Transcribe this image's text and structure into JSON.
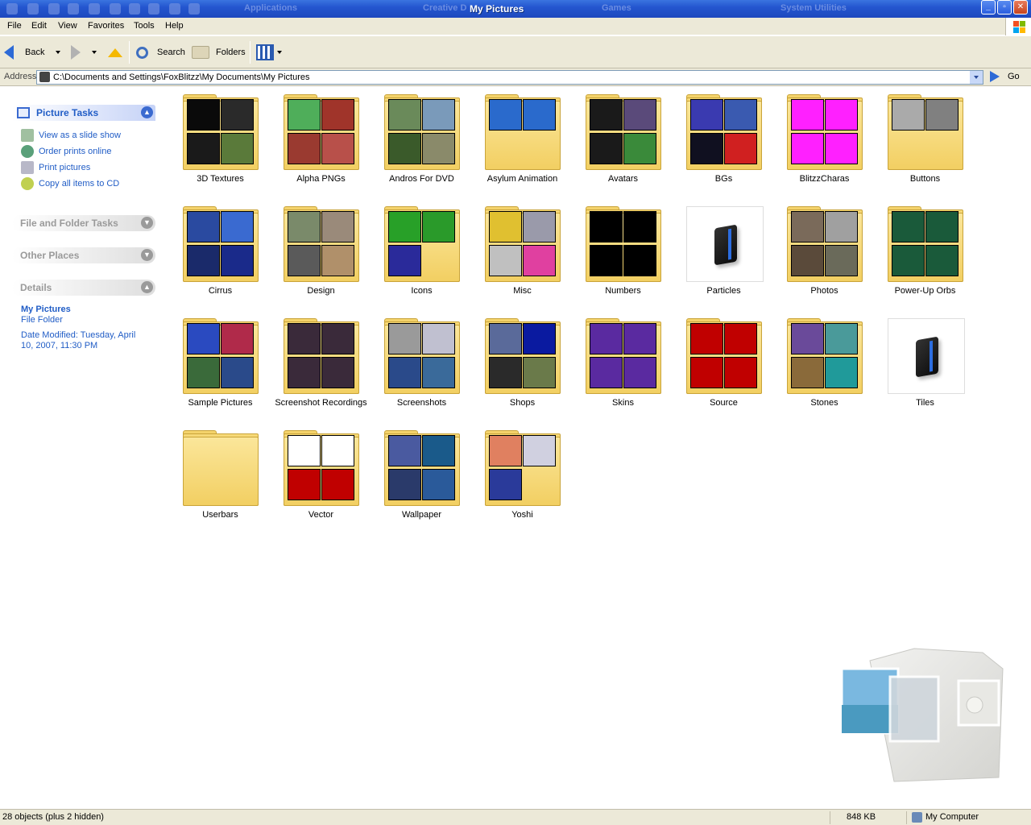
{
  "window": {
    "title": "My Pictures"
  },
  "taskbar_ghost": [
    "Applications",
    "Creative D",
    "Games",
    "System Utilities"
  ],
  "menu": [
    "File",
    "Edit",
    "View",
    "Favorites",
    "Tools",
    "Help"
  ],
  "toolbar": {
    "back": "Back",
    "search": "Search",
    "folders": "Folders"
  },
  "address": {
    "label": "Address",
    "path": "C:\\Documents and Settings\\FoxBlitzz\\My Documents\\My Pictures",
    "go": "Go"
  },
  "sidebar": {
    "picture_tasks": {
      "title": "Picture Tasks",
      "links": [
        "View as a slide show",
        "Order prints online",
        "Print pictures",
        "Copy all items to CD"
      ]
    },
    "file_folder_tasks": "File and Folder Tasks",
    "other_places": "Other Places",
    "details": {
      "title": "Details",
      "name": "My Pictures",
      "type": "File Folder",
      "modified_1": "Date Modified: Tuesday, April",
      "modified_2": "10, 2007, 11:30 PM"
    }
  },
  "items": [
    {
      "name": "3D Textures",
      "kind": "folder",
      "thumbs": [
        "#0a0a0a",
        "#2a2a2a",
        "#1a1a1a",
        "#5a7a3a"
      ]
    },
    {
      "name": "Alpha PNGs",
      "kind": "folder",
      "thumbs": [
        "#4fae5a",
        "#a0342a",
        "#9a3a30",
        "#b8504a"
      ]
    },
    {
      "name": "Andros For DVD",
      "kind": "folder",
      "thumbs": [
        "#6a8a5a",
        "#7a9aba",
        "#3a5a2a",
        "#8a8a6a"
      ]
    },
    {
      "name": "Asylum Animation",
      "kind": "folder",
      "thumbs": [
        "#2a6acc",
        "#2a6acc"
      ]
    },
    {
      "name": "Avatars",
      "kind": "folder",
      "thumbs": [
        "#1a1a1a",
        "#5a4a7a",
        "#1a1a1a",
        "#3a8a3a"
      ]
    },
    {
      "name": "BGs",
      "kind": "folder",
      "thumbs": [
        "#3a3ab0",
        "#3a5ab0",
        "#101020",
        "#d02020"
      ]
    },
    {
      "name": "BlitzzCharas",
      "kind": "folder",
      "thumbs": [
        "#ff20ff",
        "#ff20ff",
        "#ff20ff",
        "#ff20ff"
      ]
    },
    {
      "name": "Buttons",
      "kind": "folder",
      "thumbs": [
        "#aaaaaa",
        "#808080"
      ]
    },
    {
      "name": "Cirrus",
      "kind": "folder",
      "thumbs": [
        "#2a4aa0",
        "#3a6ad0",
        "#1a2a6a",
        "#1a2a8a"
      ]
    },
    {
      "name": "Design",
      "kind": "folder",
      "thumbs": [
        "#7a8a6a",
        "#9a8a7a",
        "#5a5a5a",
        "#b0906a"
      ]
    },
    {
      "name": "Icons",
      "kind": "folder",
      "thumbs": [
        "#28a028",
        "#2a9a2a",
        "#2a2a9a"
      ]
    },
    {
      "name": "Misc",
      "kind": "folder",
      "thumbs": [
        "#e0c030",
        "#9a9aaa",
        "#c0c0c0",
        "#e040a0"
      ]
    },
    {
      "name": "Numbers",
      "kind": "folder",
      "thumbs": [
        "#000000",
        "#000000",
        "#000000",
        "#000000"
      ]
    },
    {
      "name": "Particles",
      "kind": "file"
    },
    {
      "name": "Photos",
      "kind": "folder",
      "thumbs": [
        "#7a6a5a",
        "#a0a0a0",
        "#5a4a3a",
        "#6a6a5a"
      ]
    },
    {
      "name": "Power-Up Orbs",
      "kind": "folder",
      "thumbs": [
        "#1a5a3a",
        "#1a5a3a",
        "#1a5a3a",
        "#1a5a3a"
      ]
    },
    {
      "name": "Sample Pictures",
      "kind": "folder",
      "thumbs": [
        "#2a4ac0",
        "#b02a4a",
        "#3a6a3a",
        "#2a4a8a"
      ]
    },
    {
      "name": "Screenshot Recordings",
      "kind": "folder",
      "thumbs": [
        "#3a2a3a",
        "#3a2a3a",
        "#3a2a3a",
        "#3a2a3a"
      ]
    },
    {
      "name": "Screenshots",
      "kind": "folder",
      "thumbs": [
        "#9a9a9a",
        "#c0c0d0",
        "#2a4a8a",
        "#3a6a9a"
      ]
    },
    {
      "name": "Shops",
      "kind": "folder",
      "thumbs": [
        "#5a6a9a",
        "#0a1aa0",
        "#2a2a2a",
        "#6a7a4a"
      ]
    },
    {
      "name": "Skins",
      "kind": "folder",
      "thumbs": [
        "#5a2aa0",
        "#5a2aa0",
        "#5a2aa0",
        "#5a2aa0"
      ]
    },
    {
      "name": "Source",
      "kind": "folder",
      "thumbs": [
        "#c00000",
        "#c00000",
        "#c00000",
        "#c00000"
      ]
    },
    {
      "name": "Stones",
      "kind": "folder",
      "thumbs": [
        "#6a4a9a",
        "#4a9a9a",
        "#8a6a3a",
        "#209a9a"
      ]
    },
    {
      "name": "Tiles",
      "kind": "file"
    },
    {
      "name": "Userbars",
      "kind": "folder",
      "thumbs": []
    },
    {
      "name": "Vector",
      "kind": "folder",
      "thumbs": [
        "#ffffff",
        "#ffffff",
        "#c00000",
        "#c00000"
      ]
    },
    {
      "name": "Wallpaper",
      "kind": "folder",
      "thumbs": [
        "#4a5aa0",
        "#1a5a8a",
        "#2a3a6a",
        "#2a5a9a"
      ]
    },
    {
      "name": "Yoshi",
      "kind": "folder",
      "thumbs": [
        "#e08060",
        "#d0d0e0",
        "#2a3a9a"
      ]
    }
  ],
  "status": {
    "objects": "28 objects (plus 2 hidden)",
    "size": "848 KB",
    "zone": "My Computer"
  },
  "colors": {
    "title_blue": "#2456cf",
    "link_blue": "#215dc6",
    "folder_yellow": "#f7d978",
    "chrome": "#ece9d8"
  }
}
